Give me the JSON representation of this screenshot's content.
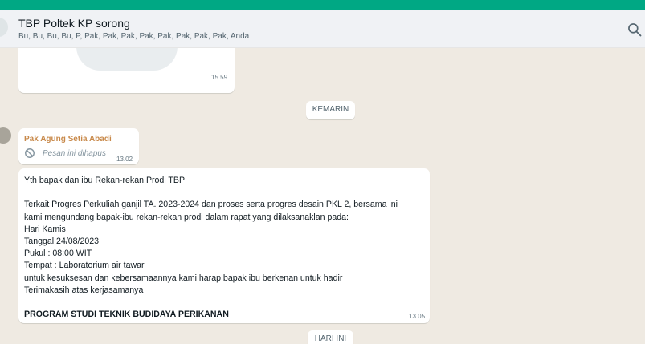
{
  "header": {
    "title": "TBP Poltek KP sorong",
    "members": "Bu, Bu, Bu, Bu, P, Pak, Pak, Pak, Pak, Pak, Pak, Pak, Pak, Anda",
    "search_icon": "search-icon"
  },
  "messages": {
    "image_time": "15.59",
    "date_yesterday": "KEMARIN",
    "deleted": {
      "sender": "Pak Agung Setia Abadi",
      "text": "Pesan ini dihapus",
      "time": "13.02",
      "icon": "blocked-icon"
    },
    "announcement": {
      "lines": [
        "Yth bapak dan ibu Rekan-rekan Prodi TBP",
        "",
        "Terkait  Progres Perkuliah ganjil TA. 2023-2024 dan  proses serta progres desain PKL 2, bersama ini",
        "kami mengundang bapak-ibu rekan-rekan prodi dalam rapat yang dilaksanaklan pada:",
        "Hari Kamis",
        "Tanggal 24/08/2023",
        "Pukul : 08:00 WIT",
        "Tempat : Laboratorium air tawar",
        "untuk kesuksesan dan kebersamaannya kami harap bapak ibu berkenan untuk hadir",
        "Terimakasih atas kerjasamanya",
        ""
      ],
      "signature": "PROGRAM STUDI TEKNIK BUDIDAYA PERIKANAN",
      "time": "13.05"
    },
    "date_today": "HARI INI"
  },
  "colors": {
    "accent": "#00a884",
    "background": "#efeae2",
    "header": "#f0f2f5",
    "sender_name": "#c8894a"
  }
}
